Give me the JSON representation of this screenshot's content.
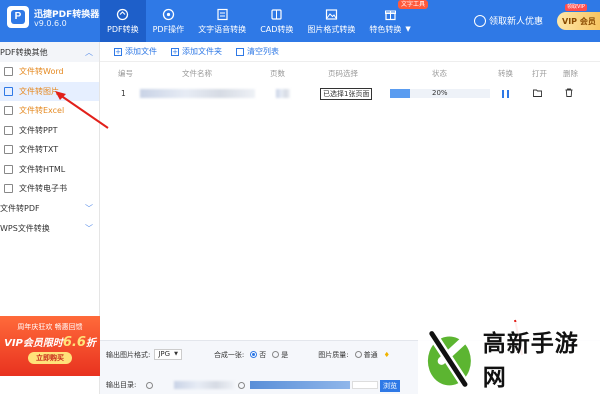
{
  "app": {
    "name": "迅捷PDF转换器",
    "version": "v9.0.6.0"
  },
  "nav": [
    {
      "label": "PDF转换",
      "icon": "refresh-icon",
      "active": true
    },
    {
      "label": "PDF操作",
      "icon": "wrench-icon"
    },
    {
      "label": "文字语音转换",
      "icon": "document-sound-icon"
    },
    {
      "label": "CAD转换",
      "icon": "cad-icon"
    },
    {
      "label": "图片格式转换",
      "icon": "image-icon"
    },
    {
      "label": "特色转换",
      "icon": "gift-icon"
    }
  ],
  "hot_badge": "文字工具",
  "user": {
    "label": "领取新人优惠",
    "vip_tag": "领取VIP",
    "vip_label": "VIP 会员"
  },
  "sidebar": {
    "group1": "PDF转换其他",
    "items": [
      {
        "label": "文件转Word",
        "state": "hl"
      },
      {
        "label": "文件转图片",
        "state": "active"
      },
      {
        "label": "文件转Excel",
        "state": "hl"
      },
      {
        "label": "文件转PPT"
      },
      {
        "label": "文件转TXT"
      },
      {
        "label": "文件转HTML"
      },
      {
        "label": "文件转电子书"
      }
    ],
    "group2": "文件转PDF",
    "group3": "WPS文件转换"
  },
  "promo": {
    "line1": "周年庆狂欢 畅惠回馈",
    "line2_prefix": "VIP会员限时",
    "line2_price": "6.6",
    "line2_suffix": "折",
    "buy": "立即购买"
  },
  "toolbar": {
    "add_file": "添加文件",
    "add_folder": "添加文件夹",
    "clear": "清空列表"
  },
  "table": {
    "headers": [
      "编号",
      "文件名称",
      "页数",
      "页码选择",
      "状态",
      "转换",
      "打开",
      "删除"
    ],
    "rows": [
      {
        "index": "1",
        "page_select": "已选择1张页面",
        "progress": 0.2,
        "percent": "20%"
      }
    ]
  },
  "bottom": {
    "format_label": "输出图片格式:",
    "format_value": "JPG",
    "merge_label": "合成一张:",
    "merge_yes": "否",
    "merge_no": "是",
    "quality_label": "图片质量:",
    "quality_value": "普通",
    "output_label": "输出目录:",
    "browse": "浏览"
  },
  "watermark": "高新手游网"
}
